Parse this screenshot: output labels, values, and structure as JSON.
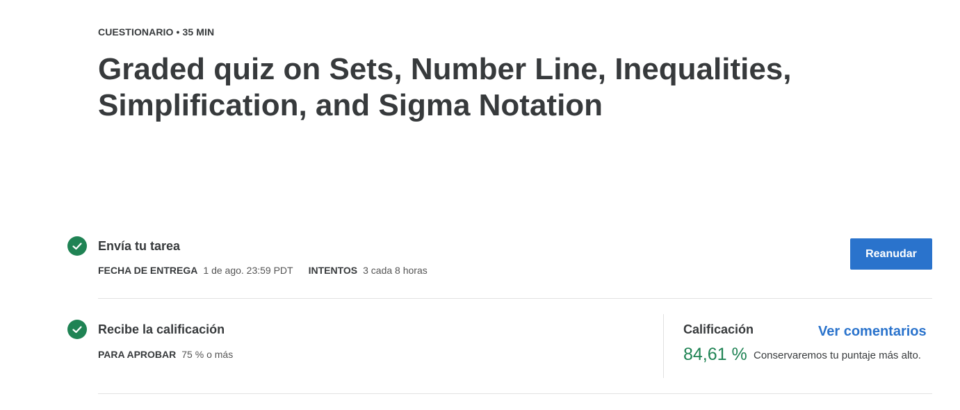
{
  "header": {
    "eyebrow": "CUESTIONARIO • 35 MIN",
    "title": "Graded quiz on Sets, Number Line, Inequalities, Simplification, and Sigma Notation"
  },
  "submit_step": {
    "title": "Envía tu tarea",
    "due_label": "FECHA DE ENTREGA",
    "due_value": "1 de ago. 23:59 PDT",
    "attempts_label": "INTENTOS",
    "attempts_value": "3 cada 8 horas",
    "button_label": "Reanudar",
    "status_icon": "check-circle-icon"
  },
  "grade_step": {
    "title": "Recibe la calificación",
    "pass_label": "PARA APROBAR",
    "pass_value": "75 % o más",
    "status_icon": "check-circle-icon"
  },
  "grade_panel": {
    "label": "Calificación",
    "feedback_link": "Ver comentarios",
    "value": "84,61 %",
    "note": "Conservaremos tu puntaje más alto."
  },
  "colors": {
    "accent": "#2a73cc",
    "success": "#1f8354",
    "text": "#373a3c",
    "divider": "#e1e1e1"
  }
}
